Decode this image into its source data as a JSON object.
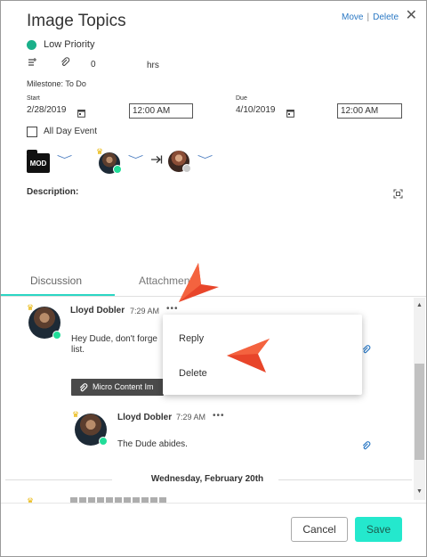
{
  "header": {
    "title": "Image Topics",
    "move_label": "Move",
    "separator": "|",
    "delete_label": "Delete",
    "close_glyph": "✕"
  },
  "priority": {
    "label": "Low Priority",
    "color": "#1ab08a"
  },
  "meta": {
    "attachments_count": "0",
    "hours_unit": "hrs",
    "milestone": "Milestone: To Do"
  },
  "dates": {
    "start_label": "Start",
    "start_date": "2/28/2019",
    "start_time": "12:00 AM",
    "due_label": "Due",
    "due_date": "4/10/2019",
    "due_time": "12:00 AM",
    "all_day_label": "All Day Event"
  },
  "assignment": {
    "type_badge": "MOD"
  },
  "description_label": "Description:",
  "tabs": [
    {
      "label": "Discussion",
      "active": true
    },
    {
      "label": "Attachments",
      "active": false
    }
  ],
  "comments": [
    {
      "author": "Lloyd Dobler",
      "time": "7:29 AM",
      "text_line1": "Hey Dude, don't forge",
      "text_line2": "list.",
      "attachment_chip": "Micro Content Im"
    },
    {
      "author": "Lloyd Dobler",
      "time": "7:29 AM",
      "text": "The Dude abides."
    }
  ],
  "date_separator": "Wednesday, February 20th",
  "context_menu": {
    "items": [
      "Reply",
      "Delete"
    ]
  },
  "footer": {
    "cancel_label": "Cancel",
    "save_label": "Save"
  },
  "colors": {
    "accent": "#24e8cd",
    "link": "#2a78c4",
    "online": "#22dd99",
    "arrow": "#e8452a"
  }
}
